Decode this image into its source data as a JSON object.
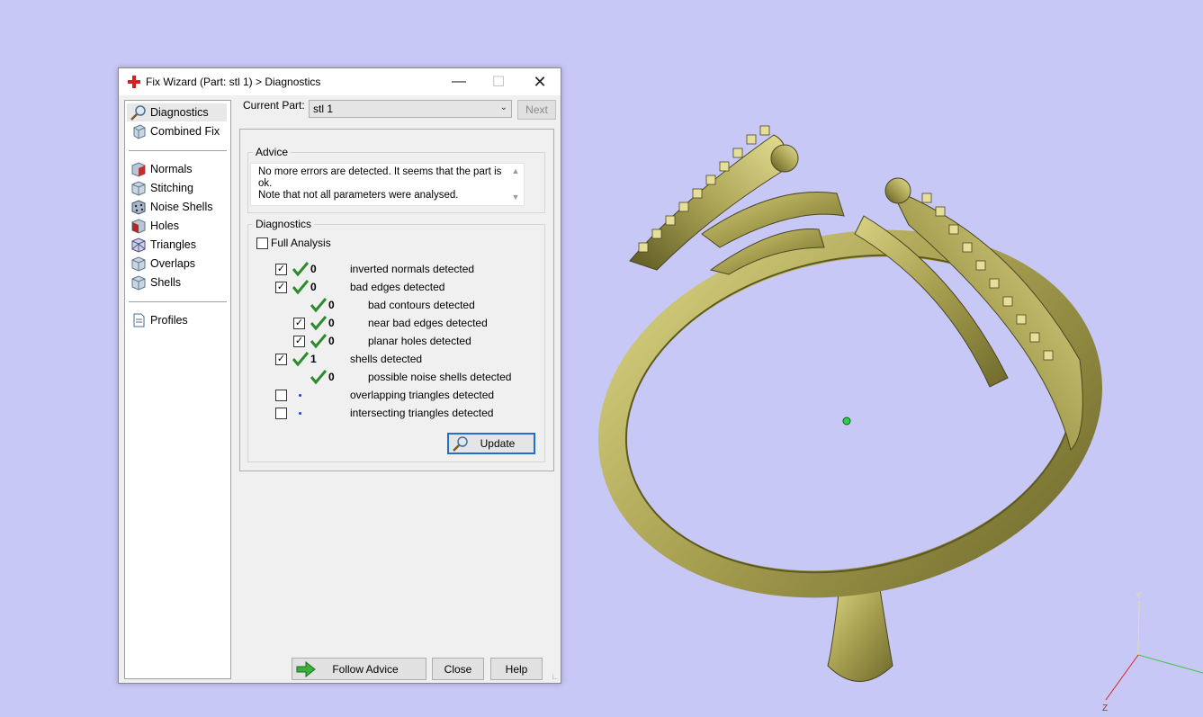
{
  "window": {
    "title": "Fix Wizard (Part: stl 1) > Diagnostics",
    "minimize_glyph": "—",
    "maximize_glyph": "☐",
    "close_glyph": "✕"
  },
  "sidebar": {
    "top_items": [
      {
        "label": "Diagnostics",
        "icon": "magnifier-icon",
        "selected": true
      },
      {
        "label": "Combined Fix",
        "icon": "cube-icon"
      }
    ],
    "fix_items": [
      {
        "label": "Normals",
        "icon": "normals-cube-icon"
      },
      {
        "label": "Stitching",
        "icon": "stitching-cube-icon"
      },
      {
        "label": "Noise Shells",
        "icon": "noise-shells-icon"
      },
      {
        "label": "Holes",
        "icon": "holes-cube-icon"
      },
      {
        "label": "Triangles",
        "icon": "triangles-cube-icon"
      },
      {
        "label": "Overlaps",
        "icon": "overlaps-cube-icon"
      },
      {
        "label": "Shells",
        "icon": "shells-cube-icon"
      }
    ],
    "profiles": {
      "label": "Profiles",
      "icon": "document-icon"
    }
  },
  "current_part": {
    "label": "Current Part:",
    "value": "stl 1",
    "next_label": "Next"
  },
  "advice": {
    "title": "Advice",
    "line1": "No more errors are detected. It seems that the part is ok.",
    "line2": "Note that not all parameters were analysed.",
    "scroll_up": "▲",
    "scroll_down": "▼"
  },
  "diagnostics": {
    "title": "Diagnostics",
    "full_analysis_label": "Full Analysis",
    "rows": [
      {
        "label": "inverted normals detected",
        "count": "0",
        "checkbox": true,
        "checked": true,
        "status": "ok"
      },
      {
        "label": "bad edges detected",
        "count": "0",
        "checkbox": true,
        "checked": true,
        "status": "ok"
      },
      {
        "label": "bad contours detected",
        "count": "0",
        "checkbox": false,
        "status": "ok"
      },
      {
        "label": "near bad edges detected",
        "count": "0",
        "checkbox": true,
        "checked": true,
        "status": "ok"
      },
      {
        "label": "planar holes detected",
        "count": "0",
        "checkbox": true,
        "checked": true,
        "status": "ok"
      },
      {
        "label": "shells detected",
        "count": "1",
        "checkbox": true,
        "checked": true,
        "status": "ok"
      },
      {
        "label": "possible noise shells detected",
        "count": "0",
        "checkbox": false,
        "status": "ok"
      },
      {
        "label": "overlapping triangles detected",
        "count": "",
        "checkbox": true,
        "checked": false,
        "status": "pending"
      },
      {
        "label": "intersecting triangles detected",
        "count": "",
        "checkbox": true,
        "checked": false,
        "status": "pending"
      }
    ],
    "check_glyph": "✓",
    "update_label": "Update"
  },
  "buttons": {
    "follow_advice": "Follow Advice",
    "close": "Close",
    "help": "Help"
  },
  "viewport": {
    "model": "ring",
    "model_color": "#a8a152",
    "background": "#c8c8f6",
    "axes": {
      "y": "Y",
      "z": "Z"
    }
  }
}
